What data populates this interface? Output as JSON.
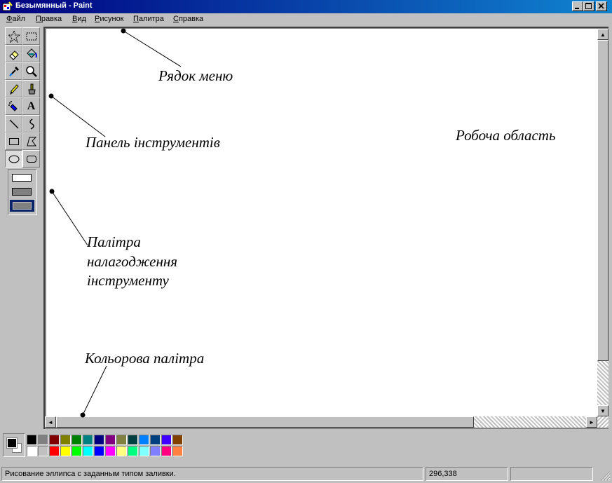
{
  "window": {
    "title": "Безымянный - Paint",
    "icon": "paint-app-icon",
    "controls": [
      "minimize-icon",
      "maximize-icon",
      "close-icon"
    ]
  },
  "menu": [
    "Файл",
    "Правка",
    "Вид",
    "Рисунок",
    "Палитра",
    "Справка"
  ],
  "tools": [
    {
      "name": "free-form-select",
      "icon": "star-select-icon"
    },
    {
      "name": "rect-select",
      "icon": "rect-select-icon"
    },
    {
      "name": "eraser",
      "icon": "eraser-icon"
    },
    {
      "name": "fill",
      "icon": "paint-bucket-icon"
    },
    {
      "name": "pick-color",
      "icon": "eyedropper-icon"
    },
    {
      "name": "magnifier",
      "icon": "magnifier-icon"
    },
    {
      "name": "pencil",
      "icon": "pencil-icon"
    },
    {
      "name": "brush",
      "icon": "brush-icon"
    },
    {
      "name": "airbrush",
      "icon": "airbrush-icon"
    },
    {
      "name": "text",
      "icon": "text-icon",
      "glyph": "A"
    },
    {
      "name": "line",
      "icon": "line-icon"
    },
    {
      "name": "curve",
      "icon": "curve-icon"
    },
    {
      "name": "rectangle",
      "icon": "rectangle-icon"
    },
    {
      "name": "polygon",
      "icon": "polygon-icon"
    },
    {
      "name": "ellipse",
      "icon": "ellipse-icon",
      "selected": true
    },
    {
      "name": "rounded-rect",
      "icon": "rounded-rect-icon"
    }
  ],
  "fill_options": [
    "outline-only",
    "outline-and-fill",
    "fill-only"
  ],
  "fill_option_selected": 2,
  "annotations": {
    "menu": "Рядок меню",
    "toolbar": "Панель інструментів",
    "workspace": "Робоча область",
    "tool_options": [
      "Палітра",
      "налагодження",
      "інструменту"
    ],
    "palette": "Кольорова палітра"
  },
  "colors": {
    "foreground": "#000000",
    "background": "#ffffff",
    "title_start": "#000080",
    "title_end": "#1084d0",
    "option_selected": "#0a246a",
    "row1": [
      "#000000",
      "#808080",
      "#800000",
      "#808000",
      "#008000",
      "#008080",
      "#000080",
      "#800080",
      "#808040",
      "#004040",
      "#0080ff",
      "#004080",
      "#4000ff",
      "#804000"
    ],
    "row2": [
      "#ffffff",
      "#c0c0c0",
      "#ff0000",
      "#ffff00",
      "#00ff00",
      "#00ffff",
      "#0000ff",
      "#ff00ff",
      "#ffff80",
      "#00ff80",
      "#80ffff",
      "#8080ff",
      "#ff0080",
      "#ff8040"
    ]
  },
  "status": {
    "text": "Рисование эллипса с заданным типом заливки.",
    "coords": "296,338"
  }
}
